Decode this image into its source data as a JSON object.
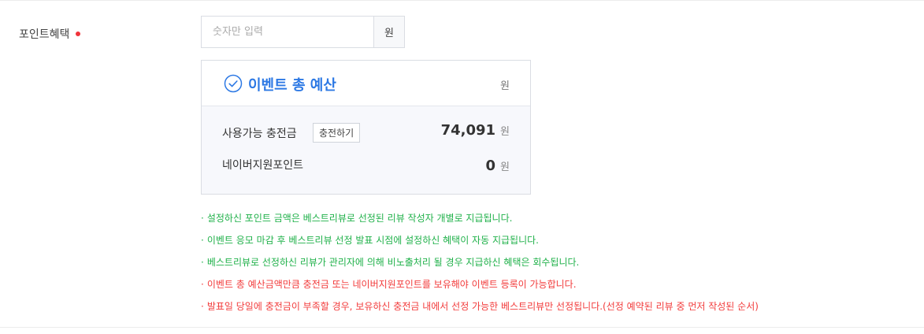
{
  "field": {
    "label": "포인트혜택",
    "input_placeholder": "숫자만 입력",
    "input_value": "",
    "unit": "원"
  },
  "budget": {
    "title": "이벤트 총 예산",
    "unit": "원",
    "rows": [
      {
        "label": "사용가능 충전금",
        "button": "충전하기",
        "value": "74,091",
        "unit": "원"
      },
      {
        "label": "네이버지원포인트",
        "value": "0",
        "unit": "원"
      }
    ]
  },
  "notes": [
    {
      "text": "설정하신 포인트 금액은 베스트리뷰로 선정된 리뷰 작성자 개별로 지급됩니다.",
      "color": "green"
    },
    {
      "text": "이벤트 응모 마감 후 베스트리뷰 선정 발표 시점에 설정하신 혜택이 자동 지급됩니다.",
      "color": "green"
    },
    {
      "text": "베스트리뷰로 선정하신 리뷰가 관리자에 의해 비노출처리 될 경우 지급하신 혜택은 회수됩니다.",
      "color": "green"
    },
    {
      "text": "이벤트 총 예산금액만큼 충전금 또는 네이버지원포인트를 보유해야 이벤트 등록이 가능합니다.",
      "color": "red"
    },
    {
      "text": "발표일 당일에 충전금이 부족할 경우, 보유하신 충전금 내에서 선정 가능한 베스트리뷰만 선정됩니다.(선정 예약된 리뷰 중 먼저 작성된 순서)",
      "color": "red"
    }
  ],
  "colors": {
    "accent": "#2c78e4",
    "required_dot": "#f0343b",
    "note_green": "#20b14a",
    "note_red": "#f23b3b"
  },
  "icons": [
    "required-dot-icon",
    "check-circle-icon"
  ]
}
